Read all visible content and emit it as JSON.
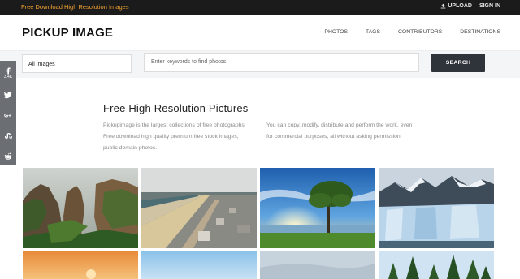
{
  "topbar": {
    "promo_text": "Free Download High Resolution Images",
    "upload_label": "UPLOAD",
    "signin_label": "SIGN IN",
    "promo_color": "#f0a030"
  },
  "header": {
    "logo_text": "PICKUP IMAGE",
    "nav": [
      "PHOTOS",
      "TAGS",
      "CONTRIBUTORS",
      "DESTINATIONS"
    ]
  },
  "search": {
    "category_value": "All Images",
    "keyword_placeholder": "Enter keywords to find photos.",
    "button_label": "SEARCH"
  },
  "social": {
    "facebook_count": "3.4K",
    "icons": [
      "facebook-icon",
      "twitter-icon",
      "google-plus-icon",
      "stumbleupon-icon",
      "reddit-icon"
    ]
  },
  "intro": {
    "title": "Free High Resolution Pictures",
    "left_text": "Pickupimage is the largest collections of free photographs. Free download high quality premium free stock images, public domain photos.",
    "right_text": "You can copy, modify, distribute and perform the work, even for commercial purposes, all without asking permission."
  },
  "gallery": {
    "tiles": [
      "mountain-cliffs-photo",
      "beach-town-aerial-photo",
      "tree-sunset-lake-photo",
      "glacier-mountains-photo",
      "orange-sunset-photo",
      "blue-sky-photo",
      "pale-sky-photo",
      "pine-trees-photo"
    ]
  }
}
